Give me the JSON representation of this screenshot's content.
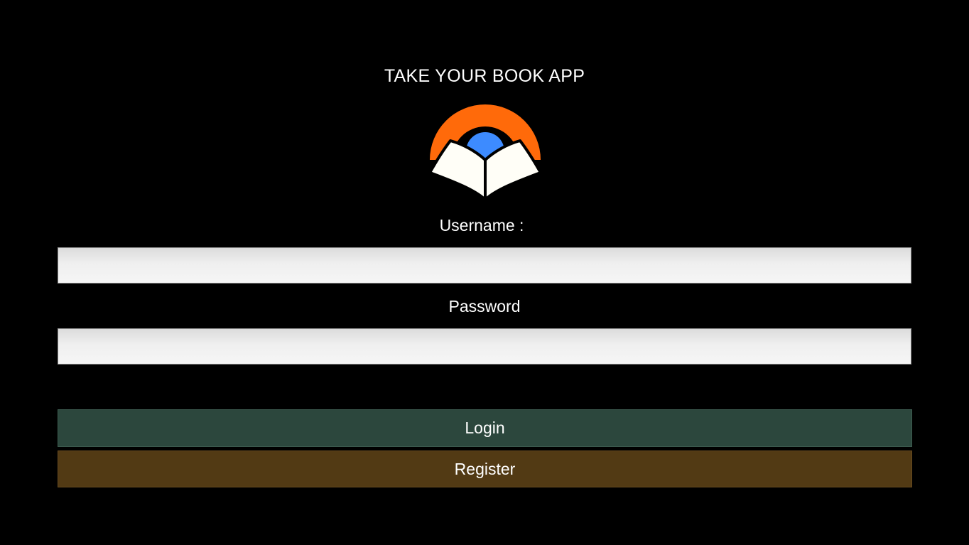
{
  "app": {
    "title": "TAKE YOUR BOOK APP",
    "logo_icon": "open-book-logo-icon"
  },
  "form": {
    "username_label": "Username :",
    "username_value": "",
    "password_label": "Password",
    "password_value": "",
    "login_label": "Login",
    "register_label": "Register"
  },
  "colors": {
    "background": "#000000",
    "logo_arc": "#ff6a0a",
    "logo_circle": "#3d8bff",
    "logo_book": "#fffef7",
    "login_button": "#2c473d",
    "register_button": "#523a14"
  }
}
